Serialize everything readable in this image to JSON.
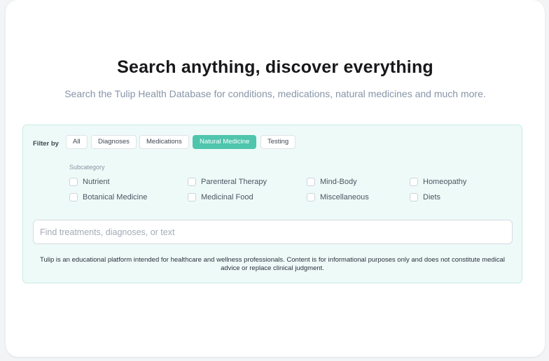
{
  "hero": {
    "title": "Search anything, discover everything",
    "subtitle": "Search the Tulip Health Database for conditions, medications, natural medicines and much more."
  },
  "filters": {
    "label": "Filter by",
    "chips": [
      "All",
      "Diagnoses",
      "Medications",
      "Natural Medicine",
      "Testing"
    ],
    "active": "Natural Medicine"
  },
  "subcategory": {
    "label": "Subcategory",
    "options": [
      "Nutrient",
      "Parenteral Therapy",
      "Mind-Body",
      "Homeopathy",
      "Botanical Medicine",
      "Medicinal Food",
      "Miscellaneous",
      "Diets"
    ]
  },
  "search": {
    "placeholder": "Find treatments, diagnoses, or text",
    "value": ""
  },
  "disclaimer": "Tulip is an educational platform intended for healthcare and wellness professionals. Content is for informational purposes only and does not constitute medical advice or replace clinical judgment.",
  "colors": {
    "accent": "#4fc5ad",
    "panel_bg": "#eefaf8",
    "panel_border": "#c6ebe4"
  }
}
